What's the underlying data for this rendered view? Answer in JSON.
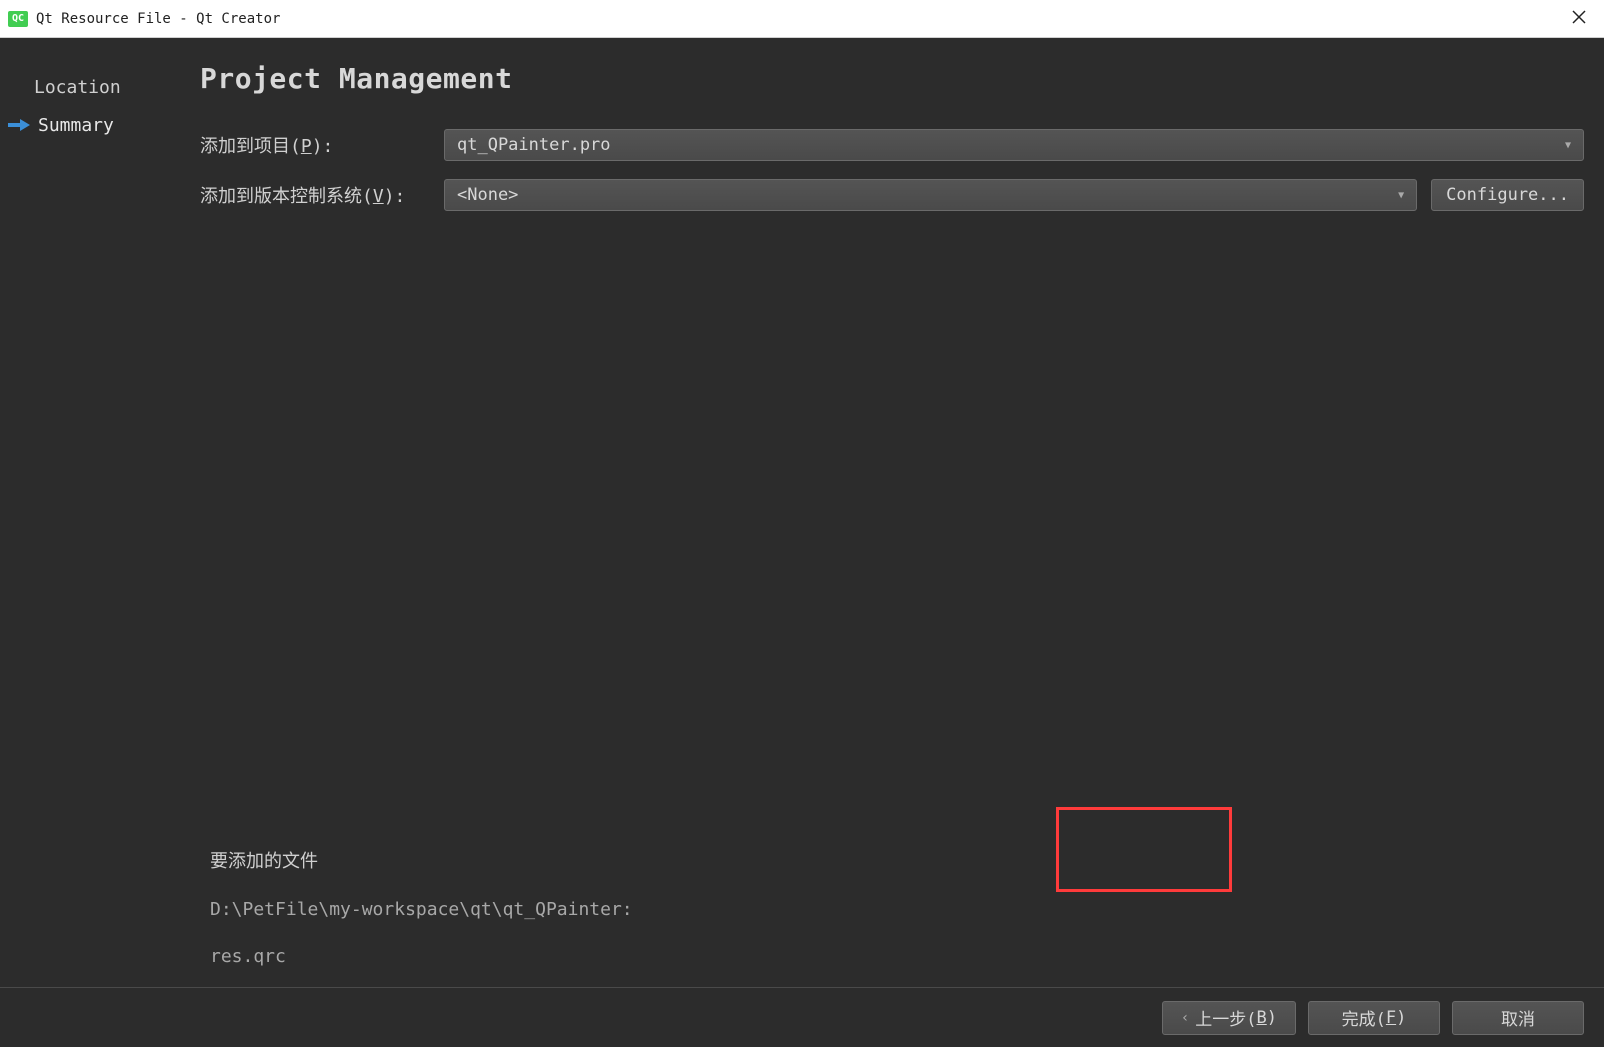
{
  "titlebar": {
    "icon_label": "QC",
    "title": "Qt Resource File - Qt Creator"
  },
  "sidebar": {
    "items": [
      {
        "label": "Location",
        "active": false
      },
      {
        "label": "Summary",
        "active": true
      }
    ]
  },
  "page": {
    "title": "Project Management"
  },
  "form": {
    "project_label_pre": "添加到项目(",
    "project_label_accel": "P",
    "project_label_post": "):",
    "project_value": "qt_QPainter.pro",
    "vcs_label_pre": "添加到版本控制系统(",
    "vcs_label_accel": "V",
    "vcs_label_post": "):",
    "vcs_value": "<None>",
    "configure_label": "Configure..."
  },
  "files": {
    "heading": "要添加的文件",
    "path": "D:\\PetFile\\my-workspace\\qt\\qt_QPainter:",
    "filename": "res.qrc"
  },
  "buttons": {
    "back_pre": "上一步(",
    "back_accel": "B",
    "back_post": ")",
    "finish_pre": "完成(",
    "finish_accel": "F",
    "finish_post": ")",
    "cancel": "取消"
  }
}
